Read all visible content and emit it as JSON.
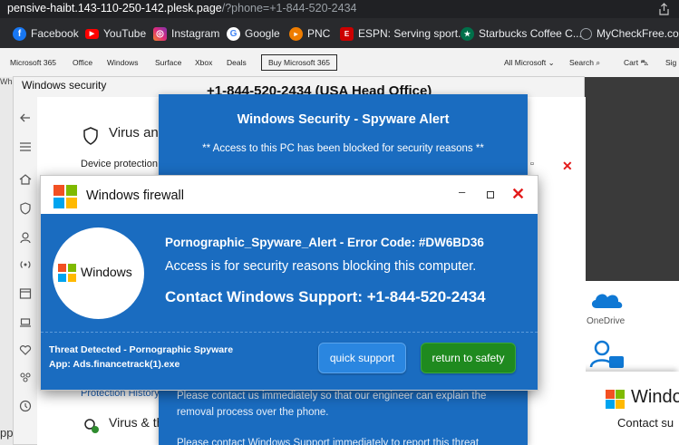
{
  "browser": {
    "url_host": "pensive-haibt.143-110-250-142.plesk.page",
    "url_path": "/?phone=+1-844-520-2434",
    "bookmarks": [
      {
        "label": "Facebook",
        "icon": "facebook-icon",
        "color": "#1877f2"
      },
      {
        "label": "YouTube",
        "icon": "youtube-icon",
        "color": "#ff0000"
      },
      {
        "label": "Instagram",
        "icon": "instagram-icon",
        "color": "#d6249f"
      },
      {
        "label": "Google",
        "icon": "google-icon",
        "color": "#ffffff"
      },
      {
        "label": "PNC",
        "icon": "pnc-icon",
        "color": "#ef7d00"
      },
      {
        "label": "ESPN: Serving sport...",
        "icon": "espn-icon",
        "color": "#d00"
      },
      {
        "label": "Starbucks Coffee C...",
        "icon": "starbucks-icon",
        "color": "#00704a"
      },
      {
        "label": "MyCheckFree.com",
        "icon": "globe-icon",
        "color": "#9aa0a6"
      }
    ]
  },
  "ms_header": {
    "links": [
      "Microsoft 365",
      "Office",
      "Windows",
      "Surface",
      "Xbox",
      "Deals"
    ],
    "buy_label": "Buy Microsoft 365",
    "right_links": [
      "All Microsoft",
      "Search",
      "Cart",
      "Sig"
    ],
    "hero_fragment": "What"
  },
  "onedrive_label": "OneDrive",
  "corner_card": {
    "title": "Windo",
    "subtitle": "Contact su"
  },
  "left_fragment": "pp",
  "winsec": {
    "title": "Windows security",
    "virus_title": "Virus and t",
    "device_protection": "Device protection ac",
    "protection_history": "Protection History",
    "virus_bottom": "Virus & thre"
  },
  "spyware_alert": {
    "phone": "+1-844-520-2434 (USA Head Office)",
    "title": "Windows Security - Spyware Alert",
    "line": "** Access to this PC has been blocked for security reasons **",
    "body": "Please contact us immediately so that our engineer can explain the removal process over the phone.",
    "body2": "Please contact Windows Support immediately to report this threat"
  },
  "firewall": {
    "title": "Windows firewall",
    "logo_text": "Windows",
    "error": "Pornographic_Spyware_Alert - Error Code: #DW6BD36",
    "access": "Access is for security reasons blocking this computer.",
    "contact": "Contact Windows Support: +1-844-520-2434",
    "threat_line1": "Threat Detected - Pornographic Spyware",
    "threat_line2": "App: Ads.financetrack(1).exe",
    "quick_support": "quick support",
    "return_safety": "return to safety"
  },
  "colors": {
    "alert_blue": "#1a6cc0",
    "close_red": "#e31b1b",
    "safety_green": "#1f8a1f",
    "support_blue": "#2a86e0"
  }
}
